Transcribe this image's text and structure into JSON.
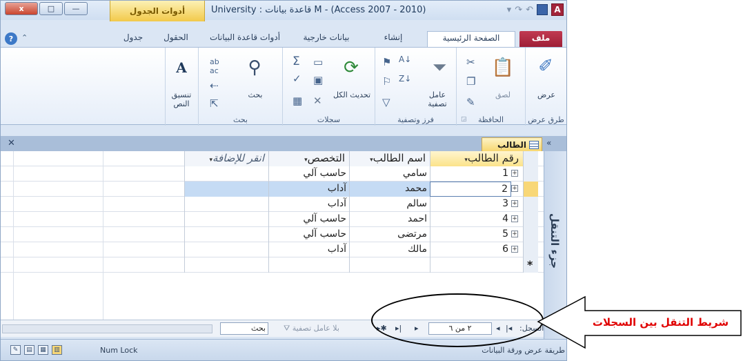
{
  "window": {
    "title": "M - (Access 2007 - 2010) قاعدة بيانات : University",
    "contextual_tab": "أدوات الجدول",
    "controls": [
      "—",
      "□",
      "x"
    ]
  },
  "ribbon_tabs": [
    {
      "label": "ملف",
      "kind": "file"
    },
    {
      "label": "الصفحة الرئيسية",
      "kind": "active"
    },
    {
      "label": "إنشاء",
      "kind": "normal"
    },
    {
      "label": "بيانات خارجية",
      "kind": "normal"
    },
    {
      "label": "أدوات قاعدة البيانات",
      "kind": "normal"
    },
    {
      "label": "الحقول",
      "kind": "normal"
    },
    {
      "label": "جدول",
      "kind": "normal"
    }
  ],
  "ribbon": {
    "views": {
      "button": "عرض",
      "group": "طرق عرض"
    },
    "clipboard": {
      "paste": "لصق",
      "group": "الحافظة"
    },
    "sort_filter": {
      "filter": "عامل تصفية",
      "group": "فرز وتصفية"
    },
    "records": {
      "refresh": "تحديث الكل",
      "group": "سجلات"
    },
    "find": {
      "find": "بحث",
      "group": "بحث"
    },
    "text_format": {
      "label": "تنسيق النص"
    }
  },
  "document": {
    "tab_label": "الطالب",
    "nav_pane_title": "جزء التنقل"
  },
  "table": {
    "columns": [
      "رقم الطالب",
      "اسم الطالب",
      "التخصص",
      "انقر للإضافة"
    ],
    "rows": [
      {
        "id": "1",
        "name": "سامي",
        "major": "حاسب آلي"
      },
      {
        "id": "2",
        "name": "محمد",
        "major": "آداب"
      },
      {
        "id": "3",
        "name": "سالم",
        "major": "آداب"
      },
      {
        "id": "4",
        "name": "احمد",
        "major": "حاسب آلي"
      },
      {
        "id": "5",
        "name": "مرتضى",
        "major": "حاسب آلي"
      },
      {
        "id": "6",
        "name": "مالك",
        "major": "آداب"
      }
    ],
    "selected_row_index": 1,
    "new_record_marker": "*"
  },
  "record_nav": {
    "label": "السجل:",
    "position": "٢ من ٦",
    "filter_status": "بلا عامل تصفية",
    "search_placeholder": "بحث"
  },
  "status_bar": {
    "view_name": "طريقة عرض ورقة البيانات",
    "num_lock": "Num Lock"
  },
  "annotation": {
    "text": "شريط التنقل بين السجلات",
    "color": "#e00000"
  }
}
